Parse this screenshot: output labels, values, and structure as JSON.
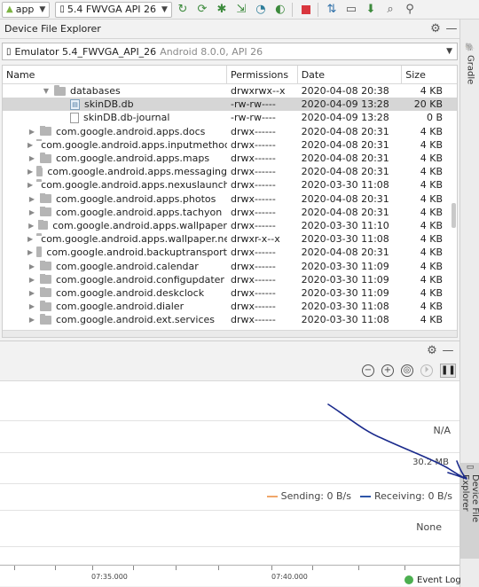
{
  "toolbar": {
    "app_config": "app",
    "device": "5.4 FWVGA API 26"
  },
  "explorer": {
    "title": "Device File Explorer",
    "device_name": "Emulator 5.4_FWVGA_API_26",
    "device_detail": "Android 8.0.0, API 26",
    "columns": {
      "name": "Name",
      "permissions": "Permissions",
      "date": "Date",
      "size": "Size"
    },
    "rows": [
      {
        "name": "databases",
        "perm": "drwxrwx--x",
        "date": "2020-04-08 20:38",
        "size": "4 KB"
      },
      {
        "name": "skinDB.db",
        "perm": "-rw-rw----",
        "date": "2020-04-09 13:28",
        "size": "20 KB"
      },
      {
        "name": "skinDB.db-journal",
        "perm": "-rw-rw----",
        "date": "2020-04-09 13:28",
        "size": "0 B"
      },
      {
        "name": "com.google.android.apps.docs",
        "perm": "drwx------",
        "date": "2020-04-08 20:31",
        "size": "4 KB"
      },
      {
        "name": "com.google.android.apps.inputmethod.hin",
        "perm": "drwx------",
        "date": "2020-04-08 20:31",
        "size": "4 KB"
      },
      {
        "name": "com.google.android.apps.maps",
        "perm": "drwx------",
        "date": "2020-04-08 20:31",
        "size": "4 KB"
      },
      {
        "name": "com.google.android.apps.messaging",
        "perm": "drwx------",
        "date": "2020-04-08 20:31",
        "size": "4 KB"
      },
      {
        "name": "com.google.android.apps.nexuslauncher",
        "perm": "drwx------",
        "date": "2020-03-30 11:08",
        "size": "4 KB"
      },
      {
        "name": "com.google.android.apps.photos",
        "perm": "drwx------",
        "date": "2020-04-08 20:31",
        "size": "4 KB"
      },
      {
        "name": "com.google.android.apps.tachyon",
        "perm": "drwx------",
        "date": "2020-04-08 20:31",
        "size": "4 KB"
      },
      {
        "name": "com.google.android.apps.wallpaper",
        "perm": "drwx------",
        "date": "2020-03-30 11:10",
        "size": "4 KB"
      },
      {
        "name": "com.google.android.apps.wallpaper.nexus",
        "perm": "drwxr-x--x",
        "date": "2020-03-30 11:08",
        "size": "4 KB"
      },
      {
        "name": "com.google.android.backuptransport",
        "perm": "drwx------",
        "date": "2020-04-08 20:31",
        "size": "4 KB"
      },
      {
        "name": "com.google.android.calendar",
        "perm": "drwx------",
        "date": "2020-03-30 11:09",
        "size": "4 KB"
      },
      {
        "name": "com.google.android.configupdater",
        "perm": "drwx------",
        "date": "2020-03-30 11:09",
        "size": "4 KB"
      },
      {
        "name": "com.google.android.deskclock",
        "perm": "drwx------",
        "date": "2020-03-30 11:09",
        "size": "4 KB"
      },
      {
        "name": "com.google.android.dialer",
        "perm": "drwx------",
        "date": "2020-03-30 11:08",
        "size": "4 KB"
      },
      {
        "name": "com.google.android.ext.services",
        "perm": "drwx------",
        "date": "2020-03-30 11:08",
        "size": "4 KB"
      }
    ]
  },
  "profiler": {
    "na_label": "N/A",
    "memory_value": "30.2 MB",
    "sending_label": "Sending: 0 B/s",
    "receiving_label": "Receiving: 0 B/s",
    "none_label": "None",
    "time_labels": [
      "07:35.000",
      "07:40.000"
    ],
    "sending_color": "#f0a66a",
    "receiving_color": "#2e55a8"
  },
  "side": {
    "gradle": "Gradle",
    "device_file_explorer": "Device File Explorer"
  },
  "status": {
    "event_log": "Event Log"
  }
}
